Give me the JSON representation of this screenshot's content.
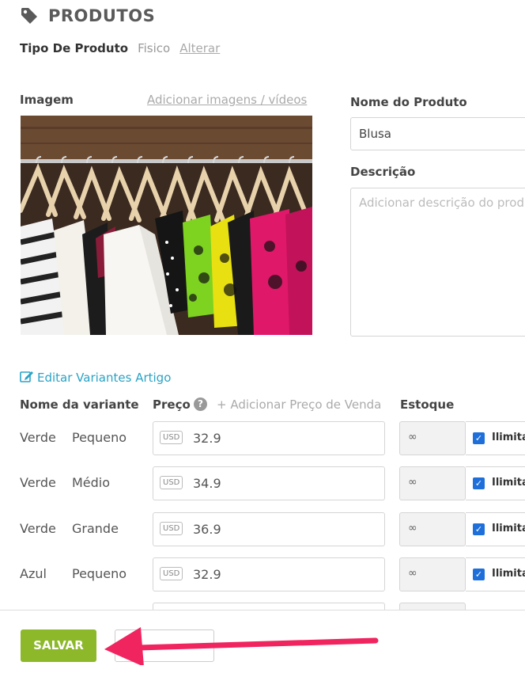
{
  "header": {
    "title": "PRODUTOS",
    "icon": "tag-icon"
  },
  "product_type": {
    "label": "Tipo De Produto",
    "value": "Fisico",
    "change_link": "Alterar"
  },
  "image": {
    "label": "Imagem",
    "add_link": "Adicionar imagens / vídeos"
  },
  "name_field": {
    "label": "Nome do Produto",
    "value": "Blusa"
  },
  "description_field": {
    "label": "Descrição",
    "placeholder": "Adicionar descrição do produto"
  },
  "variants": {
    "edit_link": "Editar Variantes Artigo",
    "headers": {
      "name": "Nome da variante",
      "price": "Preço",
      "add_sale_price": "+ Adicionar Preço de Venda",
      "stock": "Estoque"
    },
    "currency_badge": "USD",
    "infinity": "∞",
    "unlimited_label": "Ilimitado",
    "rows": [
      {
        "color": "Verde",
        "size": "Pequeno",
        "price": "32.9"
      },
      {
        "color": "Verde",
        "size": "Médio",
        "price": "34.9"
      },
      {
        "color": "Verde",
        "size": "Grande",
        "price": "36.9"
      },
      {
        "color": "Azul",
        "size": "Pequeno",
        "price": "32.9"
      }
    ]
  },
  "footer": {
    "save_label": "SALVAR",
    "cancel_label": ""
  },
  "colors": {
    "accent_green": "#8cb82a",
    "link_blue": "#2aa3c6",
    "arrow_pink": "#f0245f",
    "checkbox_blue": "#1e6fd9"
  }
}
